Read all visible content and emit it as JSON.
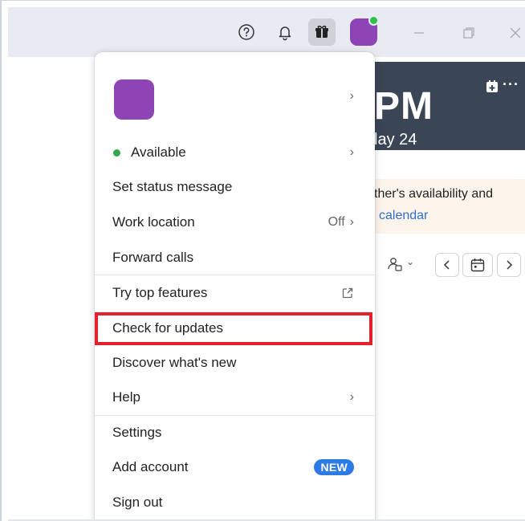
{
  "titlebar": {
    "icons": [
      "help-circle-icon",
      "bell-icon",
      "gift-icon"
    ],
    "avatar_color": "#8d45b5",
    "presence_color": "#30c04a",
    "window_controls": [
      "minimize",
      "restore",
      "close"
    ]
  },
  "hero": {
    "time": "PM",
    "date": "lay 24",
    "more": "···"
  },
  "banner": {
    "line1": "ther's availability and",
    "line2": "calendar"
  },
  "menu": {
    "status": {
      "label": "Available",
      "color": "#2ea84a"
    },
    "set_status": "Set status message",
    "work_location": {
      "label": "Work location",
      "value": "Off"
    },
    "forward_calls": "Forward calls",
    "try_features": "Try top features",
    "check_updates": "Check for updates",
    "discover": "Discover what's new",
    "help": "Help",
    "settings": "Settings",
    "add_account": {
      "label": "Add account",
      "badge": "NEW"
    },
    "sign_out": "Sign out"
  },
  "highlight_color": "#e3202b"
}
